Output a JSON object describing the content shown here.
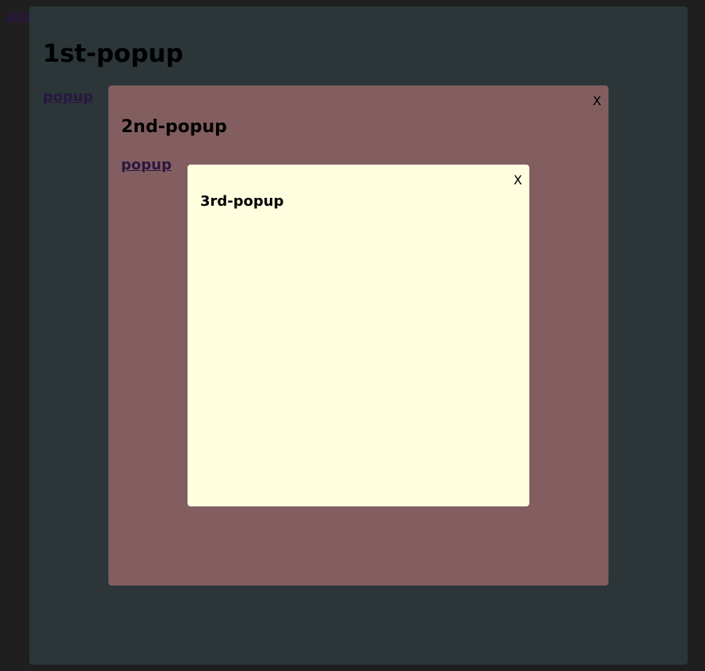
{
  "page": {
    "link_label": "popup"
  },
  "popups": [
    {
      "title": "1st-popup",
      "link_label": "popup",
      "background": "#2c3638"
    },
    {
      "title": "2nd-popup",
      "link_label": "popup",
      "close_label": "X",
      "background": "#835e61"
    },
    {
      "title": "3rd-popup",
      "close_label": "X",
      "background": "#ffffdf"
    }
  ],
  "colors": {
    "backdrop": "#1f1f1f",
    "link": "#2a1640"
  }
}
